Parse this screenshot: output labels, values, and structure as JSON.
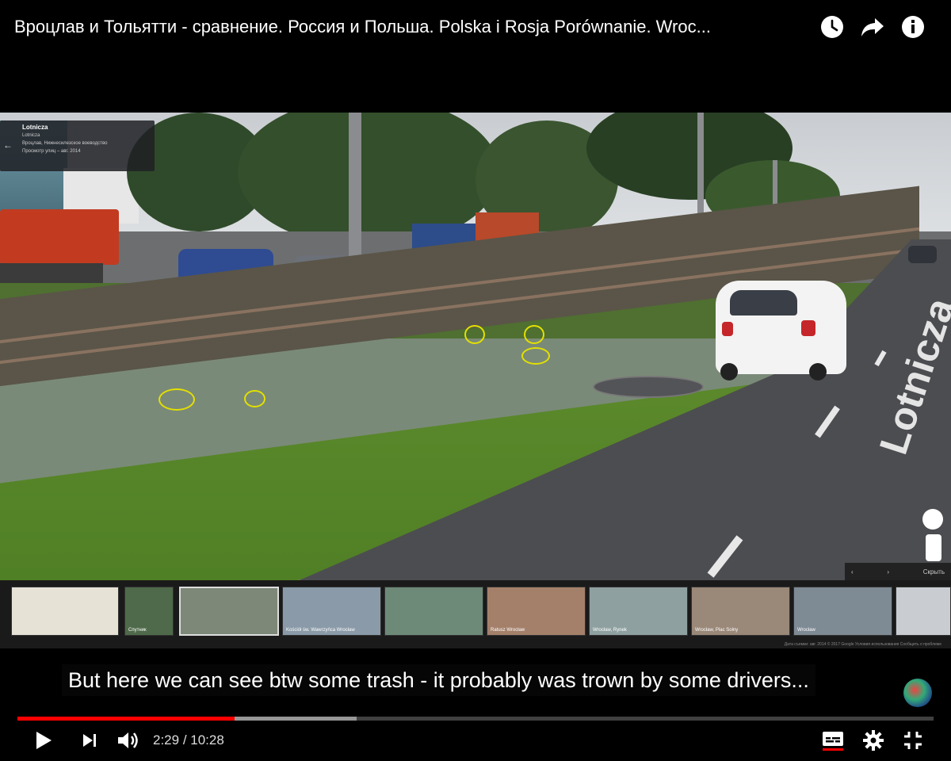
{
  "header": {
    "title": "Вроцлав и Тольятти - сравнение. Россия и Польша. Polska i Rosja Porównanie. Wroc..."
  },
  "street_view": {
    "location_title": "Lotnicza",
    "location_line1": "Lotnicza",
    "location_line2": "Вроцлав, Нижнесилезское воеводство",
    "date_line": "Просмотр улиц – авг. 2014",
    "street_label": "Lotnicza",
    "gallery_nav_label": "Скрыть",
    "gallery_thumbs": [
      {
        "label": ""
      },
      {
        "label": "Спутник"
      },
      {
        "label": ""
      },
      {
        "label": "Kościół św. Wawrzyńca Wrocław"
      },
      {
        "label": ""
      },
      {
        "label": "Ratusz Wrocław"
      },
      {
        "label": "Wrocław, Rynek"
      },
      {
        "label": "Wrocław, Plac Solny"
      },
      {
        "label": "Wrocław"
      },
      {
        "label": ""
      }
    ],
    "footer_text": "Дата съемки: авг. 2014   © 2017 Google   Условия использования   Сообщить о проблеме"
  },
  "subtitle": {
    "text": "But here we can see btw some trash - it probably was trown by some drivers..."
  },
  "player": {
    "current_time": "2:29",
    "separator": " / ",
    "duration": "10:28",
    "played_fraction": 0.237,
    "buffered_fraction": 0.37,
    "accent_color": "#ff0000"
  },
  "icons": {
    "watch_later": "clock-icon",
    "share": "share-arrow-icon",
    "info": "info-icon",
    "play": "play-icon",
    "next": "skip-next-icon",
    "volume": "volume-icon",
    "captions": "captions-icon",
    "settings": "gear-icon",
    "exit_fullscreen": "exit-fullscreen-icon"
  }
}
